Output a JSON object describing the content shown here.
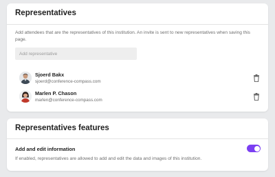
{
  "representatives": {
    "title": "Representatives",
    "description": "Add attendees that are the representatives of this institution. An invite is sent to new representatives when saving this page.",
    "add_input": {
      "placeholder": "Add representative",
      "value": ""
    },
    "items": [
      {
        "name": "Sjoerd Bakx",
        "email": "sjoerd@conference-compass.com",
        "avatar_icon": "person-photo-icon",
        "delete_icon": "trash-icon"
      },
      {
        "name": "Marlen P. Chason",
        "email": "marlen@conference-compass.com",
        "avatar_icon": "person-photo-icon",
        "delete_icon": "trash-icon"
      }
    ]
  },
  "features": {
    "title": "Representatives features",
    "add_edit": {
      "label": "Add and edit information",
      "help": "If enabled, representatives are allowed to add and edit the data and images of this institution.",
      "enabled": true
    }
  },
  "colors": {
    "accent": "#7b3ff2",
    "background": "#e9eaec",
    "card": "#ffffff",
    "muted_text": "#6d6d6d"
  }
}
